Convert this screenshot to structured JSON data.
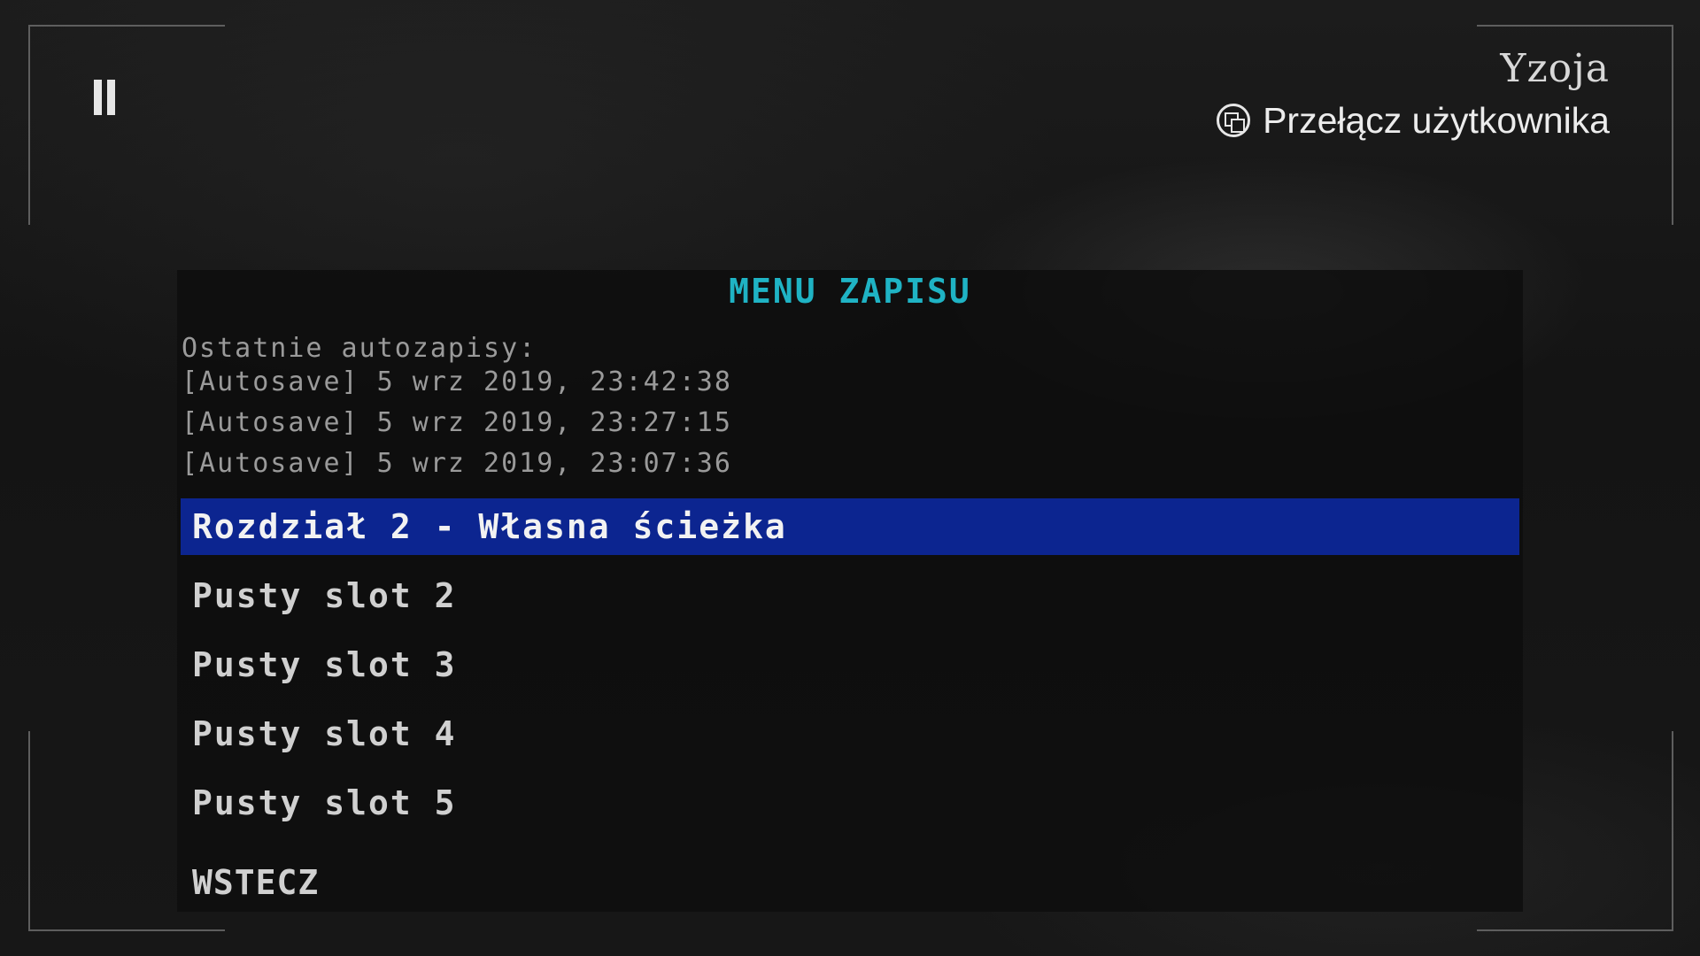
{
  "header": {
    "user_name": "Yzoja",
    "switch_user_label": "Przełącz użytkownika",
    "switch_user_icon": "switch-user-icon",
    "pause_icon": "pause-icon"
  },
  "save_menu": {
    "title": "MENU ZAPISU",
    "autosaves_heading": "Ostatnie autozapisy:",
    "autosaves": [
      "[Autosave] 5 wrz 2019, 23:42:38",
      "[Autosave] 5 wrz 2019, 23:27:15",
      "[Autosave] 5 wrz 2019, 23:07:36"
    ],
    "slots": [
      {
        "label": "Rozdział 2 - Własna ścieżka",
        "selected": true
      },
      {
        "label": "Pusty slot 2",
        "selected": false
      },
      {
        "label": "Pusty slot 3",
        "selected": false
      },
      {
        "label": "Pusty slot 4",
        "selected": false
      },
      {
        "label": "Pusty slot 5",
        "selected": false
      }
    ],
    "back_label": "WSTECZ"
  },
  "colors": {
    "title": "#1fb3c4",
    "selected_slot": "#0c2590",
    "autosave_text": "#9a9a9a"
  }
}
